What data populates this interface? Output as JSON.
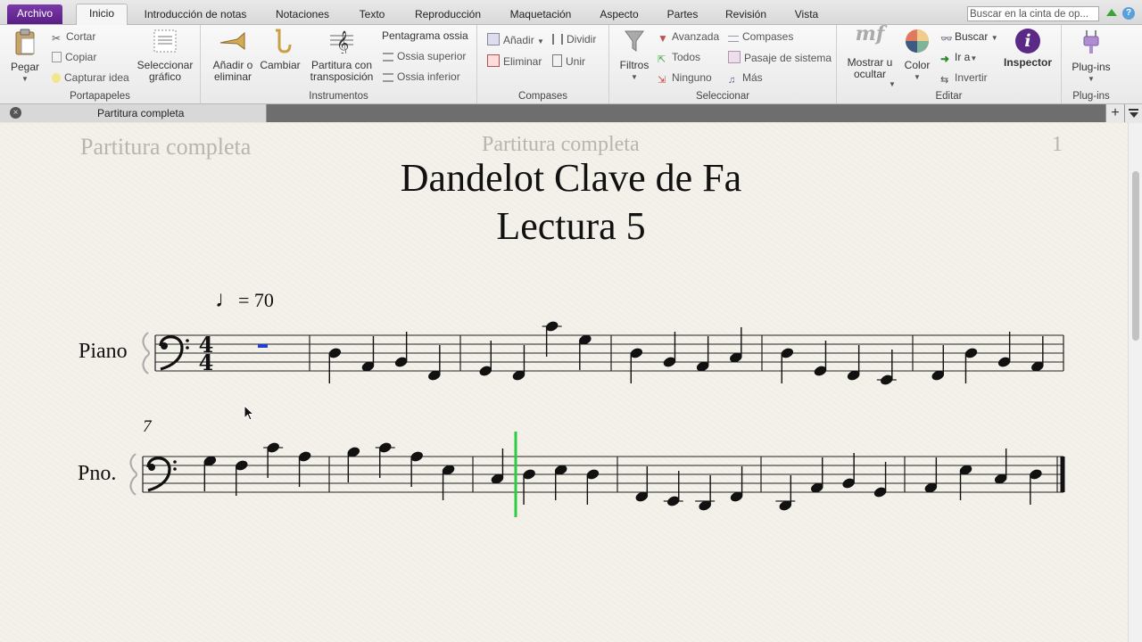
{
  "ribbon_tabs": [
    "Archivo",
    "Inicio",
    "Introducción de notas",
    "Notaciones",
    "Texto",
    "Reproducción",
    "Maquetación",
    "Aspecto",
    "Partes",
    "Revisión",
    "Vista"
  ],
  "search_placeholder": "Buscar en la cinta de op...",
  "clipboard": {
    "paste": "Pegar",
    "cut": "Cortar",
    "copy": "Copiar",
    "capture": "Capturar idea",
    "select_graphic": "Seleccionar gráfico",
    "label": "Portapapeles"
  },
  "instruments": {
    "add_remove": "Añadir o eliminar",
    "change": "Cambiar",
    "transposing": "Partitura con transposición",
    "ossia_staff": "Pentagrama ossia",
    "ossia_above": "Ossia superior",
    "ossia_below": "Ossia inferior",
    "label": "Instrumentos"
  },
  "bars": {
    "add": "Añadir",
    "delete": "Eliminar",
    "split": "Dividir",
    "join": "Unir",
    "label": "Compases"
  },
  "select": {
    "filters": "Filtros",
    "advanced": "Avanzada",
    "all": "Todos",
    "none": "Ninguno",
    "bars": "Compases",
    "system_passage": "Pasaje de sistema",
    "more": "Más",
    "label": "Seleccionar"
  },
  "edit": {
    "show_hide": "Mostrar u ocultar",
    "color": "Color",
    "find": "Buscar",
    "goto": "Ir a",
    "invert": "Invertir",
    "inspector": "Inspector",
    "label": "Editar"
  },
  "plugins": {
    "plugins": "Plug-ins",
    "label": "Plug-ins"
  },
  "document_tab": "Partitura completa",
  "page": {
    "header_left": "Partitura completa",
    "header_center": "Partitura completa",
    "page_number": "1",
    "title_line1": "Dandelot Clave de Fa",
    "title_line2": "Lectura 5",
    "tempo": "= 70",
    "instrument_full": "Piano",
    "instrument_short": "Pno.",
    "measure_number": "7"
  },
  "score": {
    "clef": "bass",
    "time_signature": "4/4",
    "tempo_bpm": 70,
    "system1_notes": [
      [
        "rest"
      ],
      [
        "D3",
        "A2",
        "B2",
        "F2"
      ],
      [
        "G2",
        "F2",
        "C4",
        "G3"
      ],
      [
        "D3",
        "B2",
        "A2",
        "C3"
      ],
      [
        "D3",
        "G2",
        "F2",
        "E2"
      ],
      [
        "F2",
        "D3",
        "B2",
        "A2"
      ]
    ],
    "system2_notes": [
      [
        "G3",
        "F3",
        "C4",
        "A3"
      ],
      [
        "B3",
        "C4",
        "A3",
        "E3"
      ],
      [
        "C3",
        "D3",
        "E3",
        "D3"
      ],
      [
        "F2",
        "E2",
        "D2",
        "F2"
      ],
      [
        "D2",
        "A2",
        "B2",
        "G2"
      ],
      [
        "A2",
        "E3",
        "C3",
        "D3"
      ]
    ],
    "playback_line_measure": 9,
    "colors": {
      "notes": "#111111",
      "playback_line": "#2ecc40",
      "selection": "#1f3fd6"
    }
  }
}
